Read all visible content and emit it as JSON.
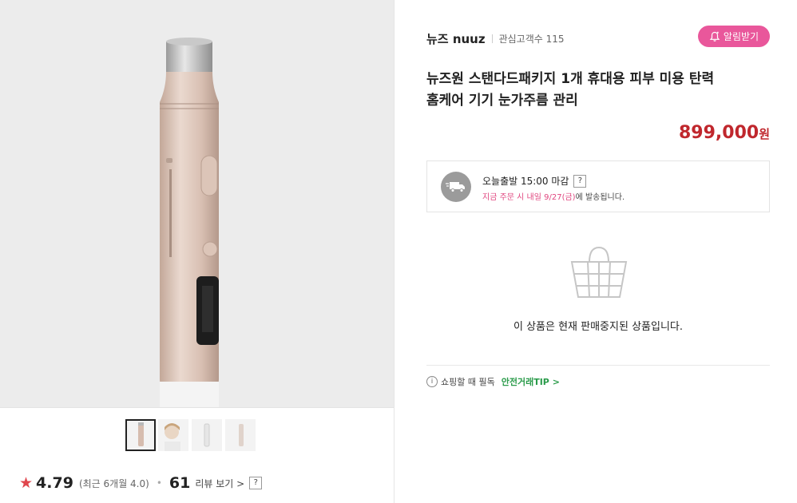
{
  "shop": {
    "brand": "뉴즈 nuuz",
    "favorites_label": "관심고객수 115",
    "alarm_label": "알림받기"
  },
  "product": {
    "title_line1": "뉴즈원 스탠다드패키지 1개 휴대용 피부 미용 탄력",
    "title_line2": "홈케어 기기 눈가주름 관리",
    "price": "899,000",
    "currency": "원"
  },
  "shipping": {
    "line1": "오늘출발 15:00 마감",
    "help": "?",
    "pink_text": "지금 주문 시 내일 9/27(금)",
    "rest_text": "에 발송됩니다."
  },
  "status": {
    "stopped_text": "이 상품은 현재 판매중지된 상품입니다."
  },
  "tip": {
    "info_icon": "i",
    "prefix": "쇼핑할 때 필독",
    "link": "안전거래TIP",
    "arrow": ">"
  },
  "rating": {
    "star": "★",
    "score": "4.79",
    "recent": "(최근 6개월 4.0)",
    "dot": "•",
    "review_count": "61",
    "review_link": "리뷰 보기",
    "chevron": ">",
    "help": "?"
  },
  "icons": [
    "bell-icon",
    "truck-icon",
    "basket-icon",
    "info-icon",
    "star-icon"
  ],
  "colors": {
    "accent_pink": "#e9579b",
    "price_red": "#c0272d",
    "tip_green": "#2a9b4a"
  }
}
